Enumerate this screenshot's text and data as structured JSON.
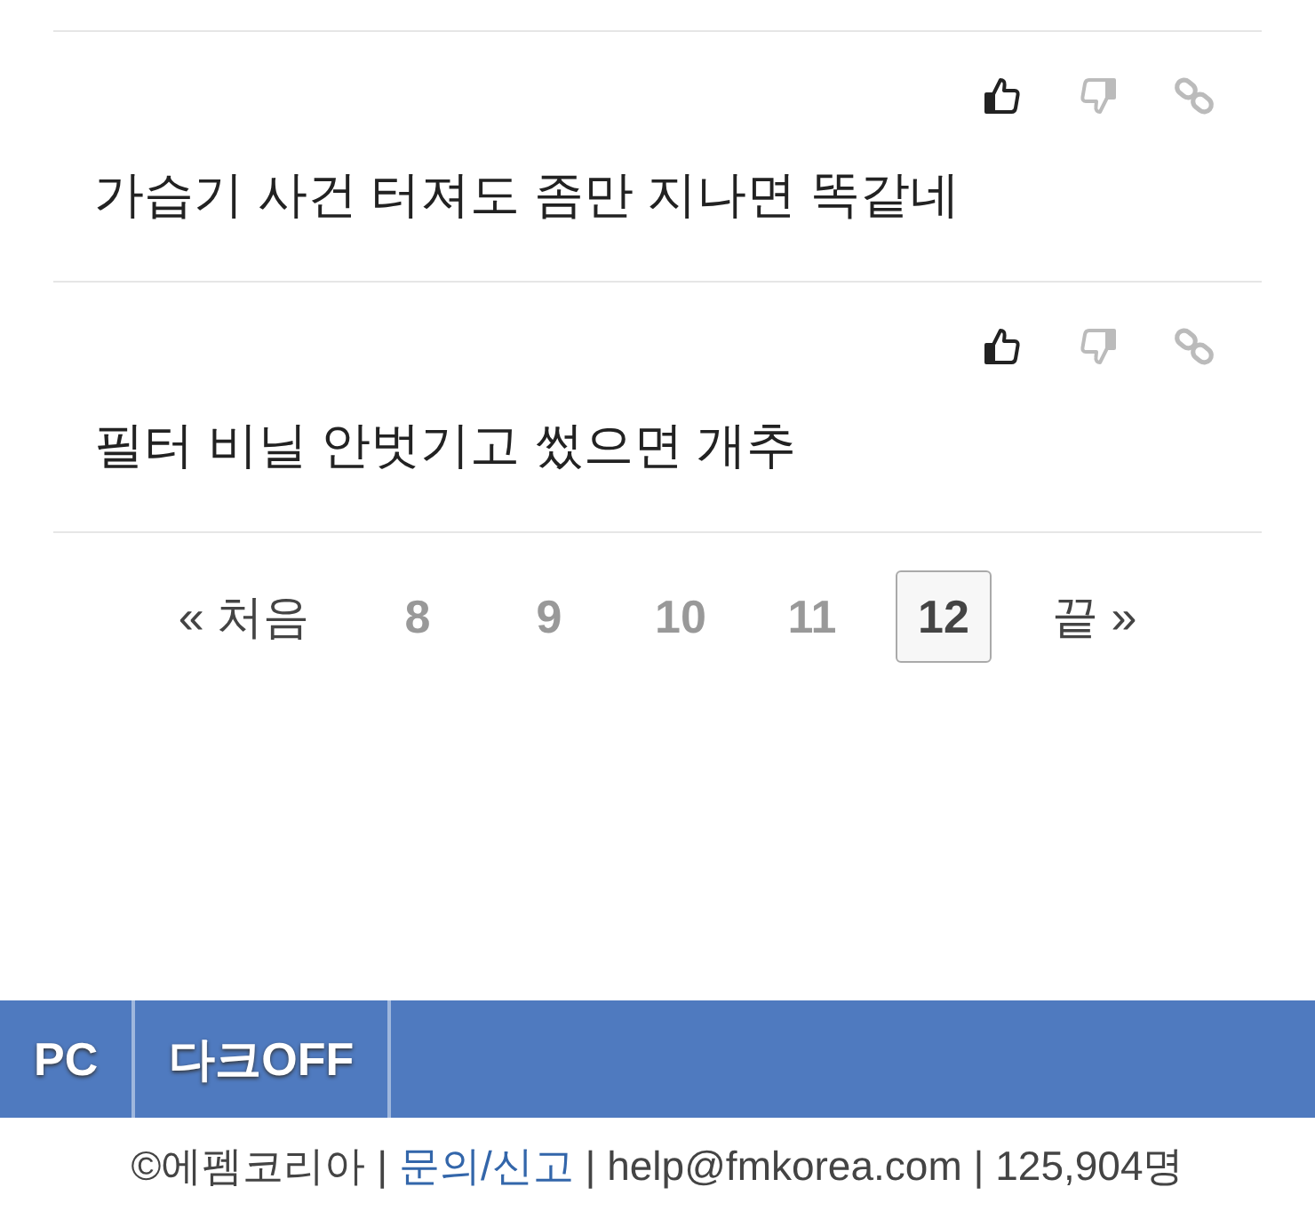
{
  "comments": [
    {
      "text": "가습기 사건 터져도 좀만 지나면 똑같네"
    },
    {
      "text": "필터 비닐 안벗기고 썼으면 개추"
    }
  ],
  "pagination": {
    "first": "« 처음",
    "last": "끝 »",
    "pages": [
      {
        "label": "8",
        "selected": false
      },
      {
        "label": "9",
        "selected": false
      },
      {
        "label": "10",
        "selected": false
      },
      {
        "label": "11",
        "selected": false
      },
      {
        "label": "12",
        "selected": true
      }
    ]
  },
  "footer_bar": {
    "buttons": [
      "PC",
      "다크OFF"
    ]
  },
  "footer": {
    "before": "©에펨코리아 | ",
    "link": "문의/신고",
    "after": " | help@fmkorea.com | 125,904명"
  }
}
